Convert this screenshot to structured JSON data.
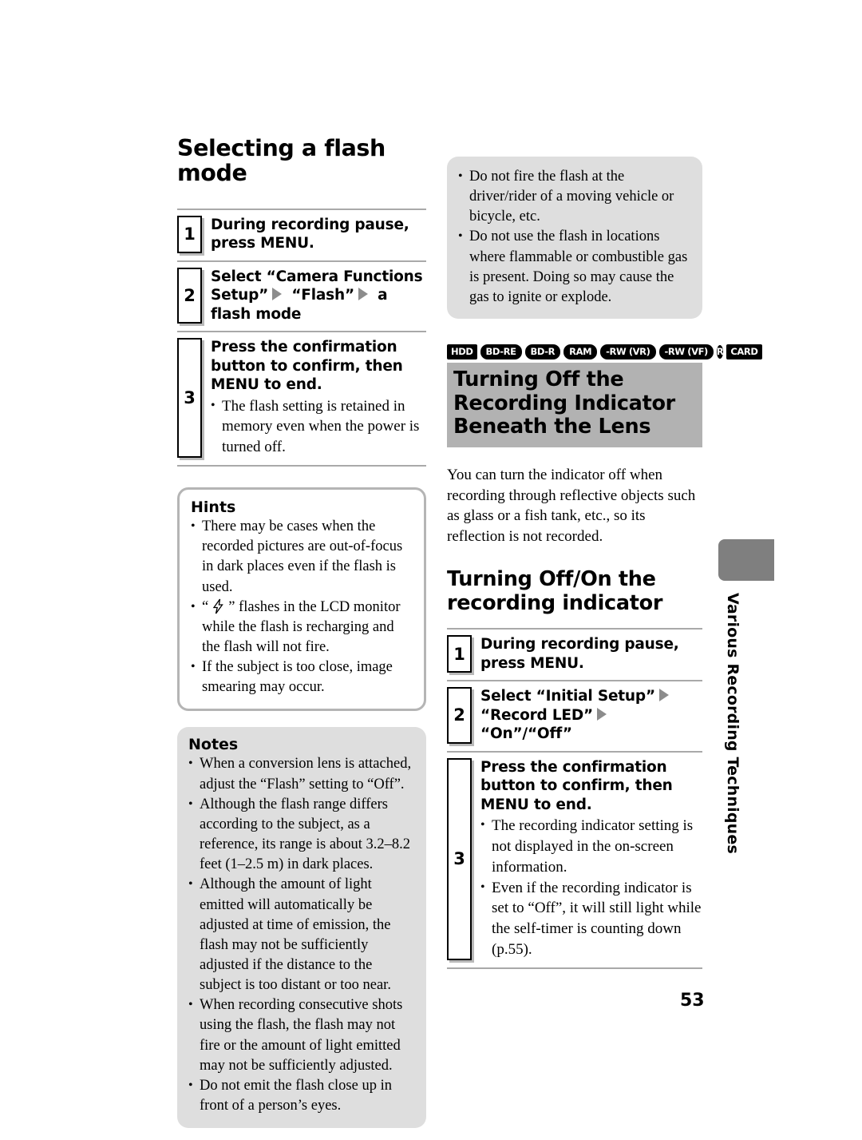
{
  "page": {
    "number": "53",
    "side_tab_label": "Various Recording Techniques"
  },
  "left_column": {
    "title": "Selecting a flash mode",
    "steps": [
      {
        "num": "1",
        "main_parts": [
          "During recording pause, press MENU."
        ],
        "notes": []
      },
      {
        "num": "2",
        "main_parts": [
          "Select “Camera Functions Setup”",
          "ARROW",
          " “Flash”",
          "ARROW",
          " a flash mode"
        ],
        "notes": []
      },
      {
        "num": "3",
        "main_parts": [
          "Press the confirmation button to confirm, then MENU to end."
        ],
        "notes": [
          "The flash setting is retained in memory even when the power is turned off."
        ]
      }
    ],
    "hints": {
      "title": "Hints",
      "items": [
        "There may be cases when the recorded pictures are out-of-focus in dark places even if the flash is used.",
        "“ FLASHICON ” flashes in the LCD monitor while the flash is recharging and the flash will not fire.",
        "If the subject is too close, image smearing may occur."
      ]
    },
    "notes": {
      "title": "Notes",
      "items": [
        "When a conversion lens is attached, adjust the “Flash” setting to “Off”.",
        "Although the flash range differs according to the subject, as a reference, its range is about 3.2–8.2 feet (1–2.5 m) in dark places.",
        "Although the amount of light emitted will automatically be adjusted at time of emission, the flash may not be sufficiently adjusted if the distance to the subject is too distant or too near.",
        "When recording consecutive shots using the flash, the flash may not fire or the amount of light emitted may not be sufficiently adjusted.",
        "Do not emit the flash close up in front of a person’s eyes."
      ]
    }
  },
  "right_column": {
    "caution": {
      "items": [
        "Do not fire the flash at the driver/rider of a moving vehicle or bicycle, etc.",
        "Do not use the flash in locations where flammable or combustible gas is present. Doing so may cause the gas to ignite or explode."
      ]
    },
    "media_icons": [
      {
        "label": "HDD",
        "shape": "sq"
      },
      {
        "label": "BD-RE",
        "shape": "pill"
      },
      {
        "label": "BD-R",
        "shape": "pill"
      },
      {
        "label": "RAM",
        "shape": "pill"
      },
      {
        "label": "-RW (VR)",
        "shape": "pill"
      },
      {
        "label": "-RW (VF)",
        "shape": "pill"
      },
      {
        "label": "R",
        "shape": "circ"
      },
      {
        "label": "CARD",
        "shape": "sq"
      }
    ],
    "section_title": "Turning Off the Recording Indicator Beneath the Lens",
    "intro_paragraph": "You can turn the indicator off when recording through reflective objects such as glass or a fish tank, etc., so its reflection is not recorded.",
    "sub_heading": "Turning Off/On the recording indicator",
    "steps": [
      {
        "num": "1",
        "main_parts": [
          "During recording pause, press MENU."
        ],
        "notes": []
      },
      {
        "num": "2",
        "main_parts": [
          "Select “Initial Setup”",
          "ARROW",
          " “Record LED”",
          "ARROW",
          " “On”/“Off”"
        ],
        "notes": []
      },
      {
        "num": "3",
        "main_parts": [
          "Press the confirmation button to confirm, then MENU to end."
        ],
        "notes": [
          "The recording indicator setting is not displayed in the on-screen information.",
          "Even if the recording indicator is set to “Off”, it will still light while the self-timer is counting down (p.55)."
        ]
      }
    ]
  },
  "colors": {
    "section_bar": "#b2b2b2",
    "box_gray": "#dedede",
    "tab_gray": "#7f7f7f",
    "rule_gray": "#a9a9a9",
    "arrow_gray": "#8c8c8c"
  }
}
